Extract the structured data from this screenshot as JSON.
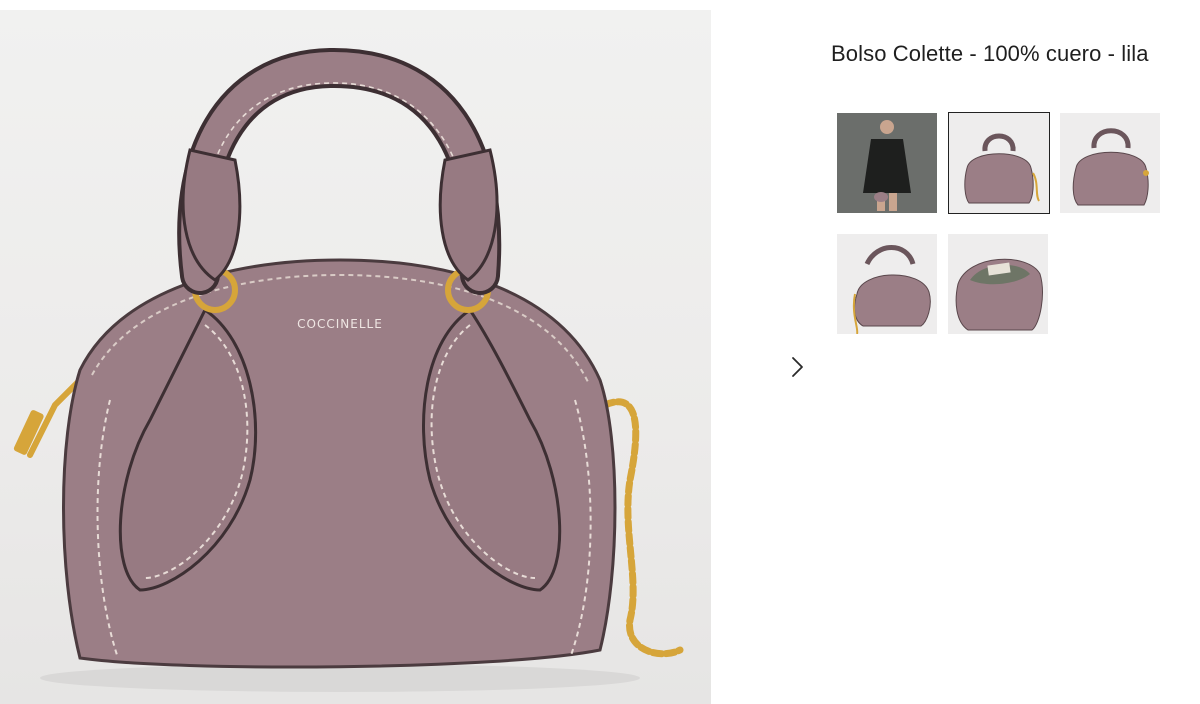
{
  "product": {
    "title": "Bolso Colette - 100% cuero - lila",
    "brand_logo_text": "COCCINELLE",
    "color": "#9b7e86"
  },
  "gallery": {
    "main_image": "bag-front-view",
    "thumbnails": [
      {
        "subject": "model-wearing-bag",
        "selected": false
      },
      {
        "subject": "bag-front-view",
        "selected": true
      },
      {
        "subject": "bag-three-quarter-view",
        "selected": false
      },
      {
        "subject": "bag-side-view",
        "selected": false
      },
      {
        "subject": "bag-open-interior",
        "selected": false
      }
    ],
    "next_icon": "chevron-right-icon"
  },
  "colors": {
    "leather": "#9b7e86",
    "leather_shadow": "#7f646c",
    "hardware_gold": "#d6a53a",
    "background": "#efeeed",
    "title_text": "#1f1f1f"
  }
}
